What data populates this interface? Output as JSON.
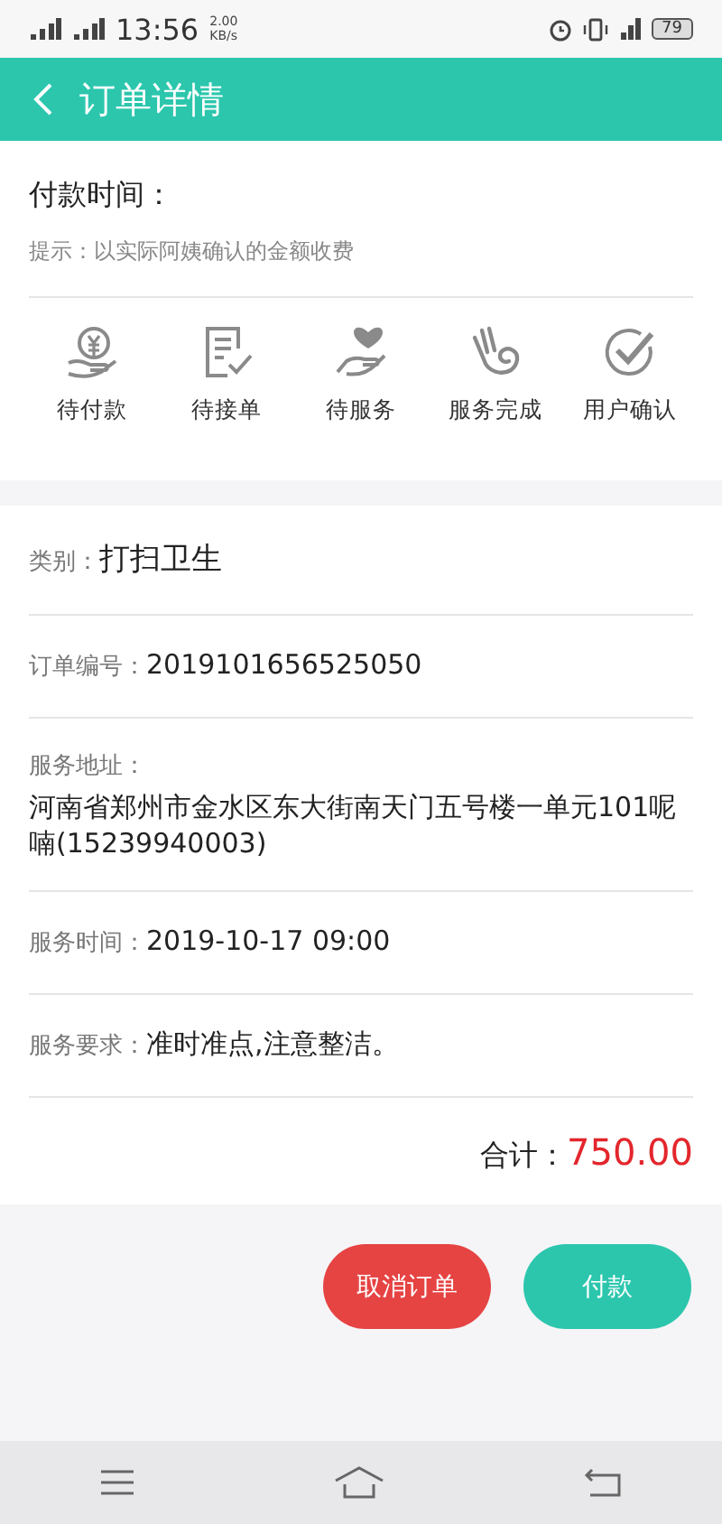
{
  "status_bar": {
    "time": "13:56",
    "speed_value": "2.00",
    "speed_unit": "KB/s",
    "battery": "79"
  },
  "header": {
    "title": "订单详情"
  },
  "payment": {
    "label": "付款时间：",
    "hint": "提示：以实际阿姨确认的金额收费"
  },
  "steps": [
    {
      "kind": "coin",
      "label": "待付款"
    },
    {
      "kind": "form",
      "label": "待接单"
    },
    {
      "kind": "heart",
      "label": "待服务"
    },
    {
      "kind": "ok",
      "label": "服务完成"
    },
    {
      "kind": "check",
      "label": "用户确认"
    }
  ],
  "fields": [
    {
      "kind": "inline",
      "label": "类别：",
      "value": "打扫卫生",
      "emphasis": true
    },
    {
      "kind": "inline",
      "label": "订单编号：",
      "value": "2019101656525050",
      "emphasis": false
    },
    {
      "kind": "block",
      "label": "服务地址：",
      "value": "河南省郑州市金水区东大街南天门五号楼一单元101呢喃(15239940003)",
      "emphasis": false
    },
    {
      "kind": "inline",
      "label": "服务时间：",
      "value": "2019-10-17 09:00",
      "emphasis": false
    },
    {
      "kind": "inline",
      "label": "服务要求：",
      "value": "准时准点,注意整洁。",
      "emphasis": false
    }
  ],
  "total": {
    "label": "合计：",
    "value": "750.00"
  },
  "buttons": [
    {
      "kind": "danger",
      "label": "取消订单"
    },
    {
      "kind": "primary",
      "label": "付款"
    }
  ]
}
